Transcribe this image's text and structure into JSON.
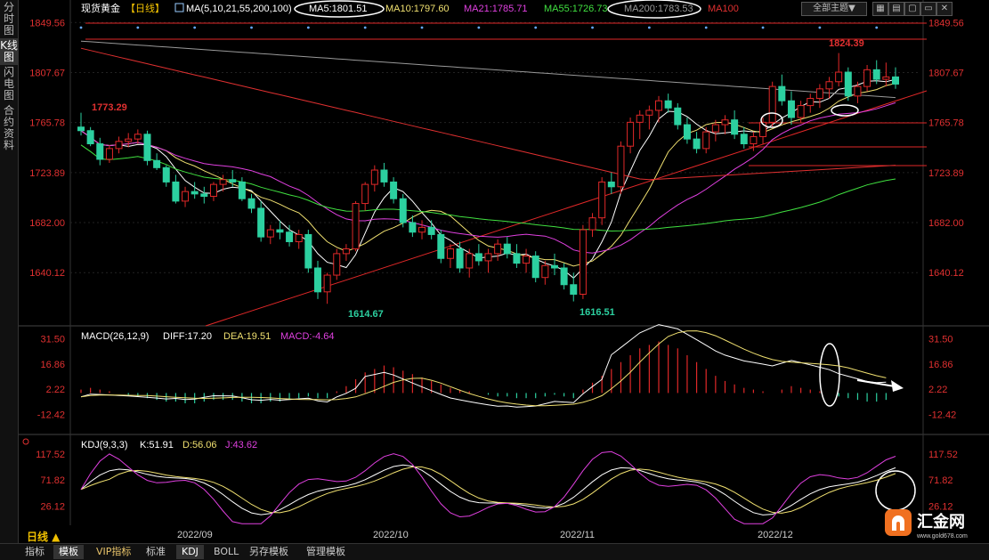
{
  "sidebar": {
    "items": [
      {
        "label": "分时图"
      },
      {
        "label": "K线图"
      },
      {
        "label": "闪电图"
      },
      {
        "label": "合约资料"
      }
    ],
    "active_index": 1
  },
  "header": {
    "instrument": "现货黄金",
    "period_badge": "【日线】",
    "ma_label": "MA(5,10,21,55,200,100)",
    "ma_values": [
      {
        "label": "MA5:1801.51",
        "color": "#ffffff"
      },
      {
        "label": "MA10:1797.60",
        "color": "#f0e070"
      },
      {
        "label": "MA21:1785.71",
        "color": "#e040e0"
      },
      {
        "label": "MA55:1726.73",
        "color": "#40e040"
      },
      {
        "label": "MA200:1783.53",
        "color": "#999999"
      },
      {
        "label": "MA100",
        "color": "#e03030"
      }
    ],
    "theme_button": "全部主题▼"
  },
  "price_axis": {
    "ticks": [
      "1849.56",
      "1807.67",
      "1765.78",
      "1723.89",
      "1682.00",
      "1640.12"
    ]
  },
  "annotations": {
    "high_1": "1824.39",
    "low_1": "1614.67",
    "low_2": "1616.51",
    "left_high": "1773.29"
  },
  "macd": {
    "title": "MACD(26,12,9)",
    "diff": "DIFF:17.20",
    "dea": "DEA:19.51",
    "macd": "MACD:-4.64",
    "ticks": [
      "31.50",
      "16.86",
      "2.22",
      "-12.42"
    ]
  },
  "kdj": {
    "title": "KDJ(9,3,3)",
    "k": "K:51.91",
    "d": "D:56.06",
    "j": "J:43.62",
    "ticks": [
      "117.52",
      "71.82",
      "26.12"
    ]
  },
  "x_axis": {
    "labels": [
      "2022/09",
      "2022/10",
      "2022/11",
      "2022/12"
    ]
  },
  "bottom_tabs": [
    {
      "label": "指标"
    },
    {
      "label": "模板"
    },
    {
      "label": "VIP指标"
    },
    {
      "label": "标准"
    },
    {
      "label": "KDJ"
    },
    {
      "label": "BOLL"
    },
    {
      "label": "另存模板"
    },
    {
      "label": "管理模板"
    }
  ],
  "period_button": "日线 ▲",
  "logo": {
    "name": "汇金网",
    "url_text": "www.gold678.com"
  },
  "colors": {
    "up": "#e02828",
    "down": "#2cd0a0",
    "ma5": "#ffffff",
    "ma10": "#f0e070",
    "ma21": "#e040e0",
    "ma55": "#40e040",
    "ma200": "#999999",
    "ma100": "#e03030",
    "axis_text": "#e03030"
  },
  "chart_data": {
    "type": "candlestick",
    "title": "现货黄金 日线",
    "x": [
      "2022/09",
      "2022/10",
      "2022/11",
      "2022/12"
    ],
    "ylim": [
      1600,
      1855
    ],
    "candles": [
      [
        1762,
        1774,
        1755,
        1759
      ],
      [
        1759,
        1762,
        1746,
        1748
      ],
      [
        1748,
        1753,
        1730,
        1735
      ],
      [
        1735,
        1747,
        1732,
        1744
      ],
      [
        1744,
        1754,
        1740,
        1750
      ],
      [
        1750,
        1757,
        1745,
        1752
      ],
      [
        1752,
        1760,
        1748,
        1756
      ],
      [
        1756,
        1759,
        1730,
        1734
      ],
      [
        1734,
        1740,
        1726,
        1728
      ],
      [
        1728,
        1730,
        1712,
        1716
      ],
      [
        1716,
        1722,
        1698,
        1700
      ],
      [
        1700,
        1712,
        1695,
        1708
      ],
      [
        1708,
        1716,
        1702,
        1706
      ],
      [
        1706,
        1712,
        1698,
        1704
      ],
      [
        1704,
        1716,
        1700,
        1714
      ],
      [
        1714,
        1722,
        1708,
        1718
      ],
      [
        1718,
        1726,
        1712,
        1716
      ],
      [
        1716,
        1720,
        1700,
        1702
      ],
      [
        1702,
        1706,
        1690,
        1694
      ],
      [
        1694,
        1700,
        1666,
        1670
      ],
      [
        1670,
        1680,
        1664,
        1676
      ],
      [
        1676,
        1684,
        1668,
        1674
      ],
      [
        1674,
        1680,
        1662,
        1666
      ],
      [
        1666,
        1676,
        1660,
        1672
      ],
      [
        1672,
        1676,
        1640,
        1644
      ],
      [
        1644,
        1650,
        1618,
        1624
      ],
      [
        1624,
        1640,
        1614,
        1638
      ],
      [
        1638,
        1660,
        1634,
        1656
      ],
      [
        1656,
        1664,
        1650,
        1660
      ],
      [
        1660,
        1700,
        1658,
        1698
      ],
      [
        1698,
        1716,
        1692,
        1714
      ],
      [
        1714,
        1730,
        1708,
        1726
      ],
      [
        1726,
        1732,
        1712,
        1716
      ],
      [
        1716,
        1720,
        1698,
        1702
      ],
      [
        1702,
        1706,
        1678,
        1682
      ],
      [
        1682,
        1688,
        1670,
        1674
      ],
      [
        1674,
        1684,
        1668,
        1678
      ],
      [
        1678,
        1684,
        1668,
        1672
      ],
      [
        1672,
        1676,
        1648,
        1652
      ],
      [
        1652,
        1664,
        1644,
        1660
      ],
      [
        1660,
        1666,
        1640,
        1644
      ],
      [
        1644,
        1660,
        1636,
        1656
      ],
      [
        1656,
        1664,
        1646,
        1650
      ],
      [
        1650,
        1660,
        1640,
        1656
      ],
      [
        1656,
        1668,
        1650,
        1664
      ],
      [
        1664,
        1670,
        1652,
        1656
      ],
      [
        1656,
        1664,
        1644,
        1648
      ],
      [
        1648,
        1660,
        1640,
        1654
      ],
      [
        1654,
        1658,
        1632,
        1636
      ],
      [
        1636,
        1650,
        1630,
        1646
      ],
      [
        1646,
        1656,
        1638,
        1644
      ],
      [
        1644,
        1648,
        1626,
        1630
      ],
      [
        1630,
        1640,
        1616,
        1622
      ],
      [
        1622,
        1680,
        1618,
        1676
      ],
      [
        1676,
        1690,
        1670,
        1686
      ],
      [
        1686,
        1720,
        1680,
        1716
      ],
      [
        1716,
        1724,
        1706,
        1712
      ],
      [
        1712,
        1750,
        1706,
        1746
      ],
      [
        1746,
        1770,
        1740,
        1766
      ],
      [
        1766,
        1776,
        1752,
        1772
      ],
      [
        1772,
        1780,
        1760,
        1776
      ],
      [
        1776,
        1788,
        1766,
        1784
      ],
      [
        1784,
        1790,
        1774,
        1778
      ],
      [
        1778,
        1782,
        1760,
        1764
      ],
      [
        1764,
        1770,
        1748,
        1752
      ],
      [
        1752,
        1758,
        1740,
        1744
      ],
      [
        1744,
        1762,
        1740,
        1758
      ],
      [
        1758,
        1768,
        1750,
        1764
      ],
      [
        1764,
        1772,
        1756,
        1768
      ],
      [
        1768,
        1776,
        1752,
        1756
      ],
      [
        1756,
        1762,
        1744,
        1748
      ],
      [
        1748,
        1758,
        1742,
        1754
      ],
      [
        1754,
        1770,
        1748,
        1766
      ],
      [
        1766,
        1800,
        1762,
        1796
      ],
      [
        1796,
        1806,
        1780,
        1784
      ],
      [
        1784,
        1792,
        1764,
        1770
      ],
      [
        1770,
        1784,
        1766,
        1780
      ],
      [
        1780,
        1790,
        1774,
        1786
      ],
      [
        1786,
        1798,
        1778,
        1794
      ],
      [
        1794,
        1804,
        1786,
        1800
      ],
      [
        1800,
        1824,
        1796,
        1808
      ],
      [
        1808,
        1812,
        1784,
        1788
      ],
      [
        1788,
        1800,
        1782,
        1796
      ],
      [
        1796,
        1814,
        1792,
        1810
      ],
      [
        1810,
        1818,
        1798,
        1802
      ],
      [
        1802,
        1816,
        1796,
        1804
      ],
      [
        1804,
        1812,
        1794,
        1798
      ]
    ],
    "series": [
      {
        "name": "MA5"
      },
      {
        "name": "MA10"
      },
      {
        "name": "MA21"
      },
      {
        "name": "MA55"
      },
      {
        "name": "MA200"
      },
      {
        "name": "MA100"
      }
    ],
    "macd_hist": [
      2,
      3,
      2,
      1,
      0,
      -1,
      -2,
      -3,
      -4,
      -5,
      -5,
      -6,
      -6,
      -5,
      -4,
      -4,
      -4,
      -5,
      -6,
      -6,
      -5,
      -5,
      -4,
      -3,
      -2,
      -3,
      -3,
      1,
      4,
      8,
      12,
      14,
      16,
      15,
      13,
      11,
      9,
      7,
      5,
      3,
      2,
      1,
      0,
      -1,
      -2,
      -2,
      -3,
      -3,
      -3,
      -2,
      -1,
      -2,
      -3,
      2,
      6,
      10,
      14,
      18,
      22,
      26,
      28,
      30,
      28,
      26,
      22,
      18,
      14,
      10,
      7,
      5,
      3,
      2,
      1,
      0,
      2,
      4,
      3,
      2,
      1,
      0,
      -2,
      -3,
      -4,
      -5,
      -5,
      -4
    ],
    "macd_ticks": [
      31.5,
      16.86,
      2.22,
      -12.42
    ],
    "kdj_ticks": [
      117.52,
      71.82,
      26.12
    ]
  }
}
